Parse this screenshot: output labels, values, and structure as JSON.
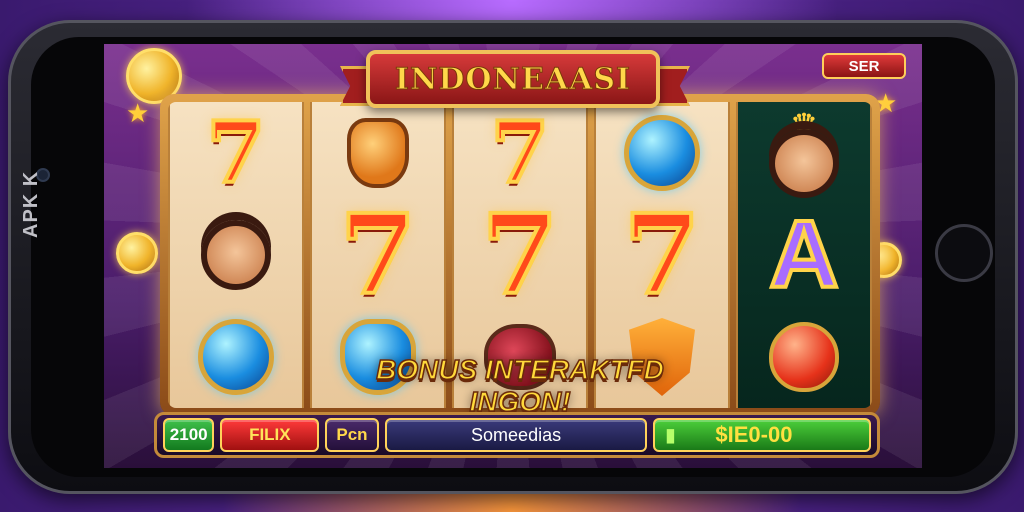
{
  "device": {
    "side_label": "APK K"
  },
  "game": {
    "title": "INDONEAASI",
    "top_badge": "SER",
    "bonus_text": "BONUS INTERAKTFD INGON!",
    "reels": [
      [
        "seven",
        "face-girl",
        "orb"
      ],
      [
        "jar",
        "seven",
        "orb-pot"
      ],
      [
        "seven-small",
        "seven",
        "rose"
      ],
      [
        "orb",
        "seven",
        "shield"
      ],
      [
        "face-queen",
        "letter-a",
        "apple"
      ]
    ],
    "letter_a": "A",
    "seven": "7"
  },
  "controls": {
    "bet_value": "2100",
    "spin_label": "FILIX",
    "mode_label": "Pcn",
    "info_label": "Someedias",
    "win_value": "$IE0-00"
  },
  "colors": {
    "accent_gold": "#ffd84a",
    "reel_frame": "#e0a34a",
    "win_green": "#1a7a18",
    "spin_red": "#a01010"
  }
}
